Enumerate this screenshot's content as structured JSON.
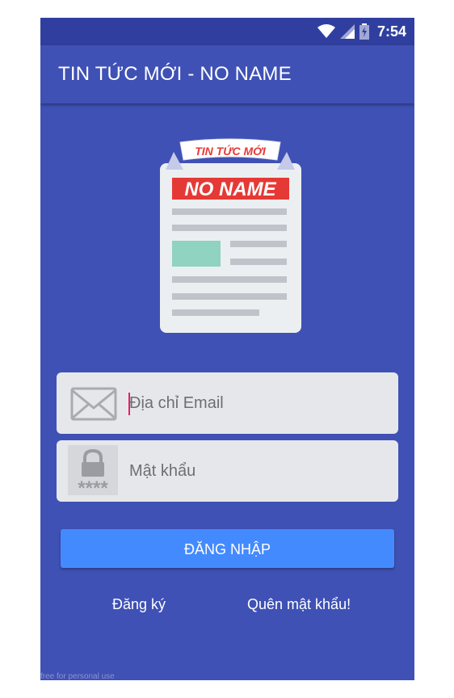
{
  "status_bar": {
    "time": "7:54"
  },
  "app_bar": {
    "title": "TIN TỨC MỚI - NO NAME"
  },
  "logo": {
    "ribbon_text": "TIN TỨC MỚI",
    "banner_text": "NO NAME"
  },
  "login_form": {
    "email_placeholder": "Địa chỉ Email",
    "password_placeholder": "Mật khẩu",
    "password_mask": "****",
    "login_button_label": "ĐĂNG NHẬP"
  },
  "links": {
    "register": "Đăng ký",
    "forgot_password": "Quên mật khẩu!"
  },
  "watermark": "free for personal use",
  "colors": {
    "primary": "#3f51b5",
    "primary_dark": "#303f9f",
    "accent_button": "#448aff",
    "field_background": "#e6e7ea",
    "logo_banner_red": "#e53935",
    "cursor_pink": "#e91e63"
  },
  "icons": [
    "wifi-icon",
    "cell-signal-icon",
    "battery-charging-icon",
    "envelope-icon",
    "lock-icon"
  ]
}
